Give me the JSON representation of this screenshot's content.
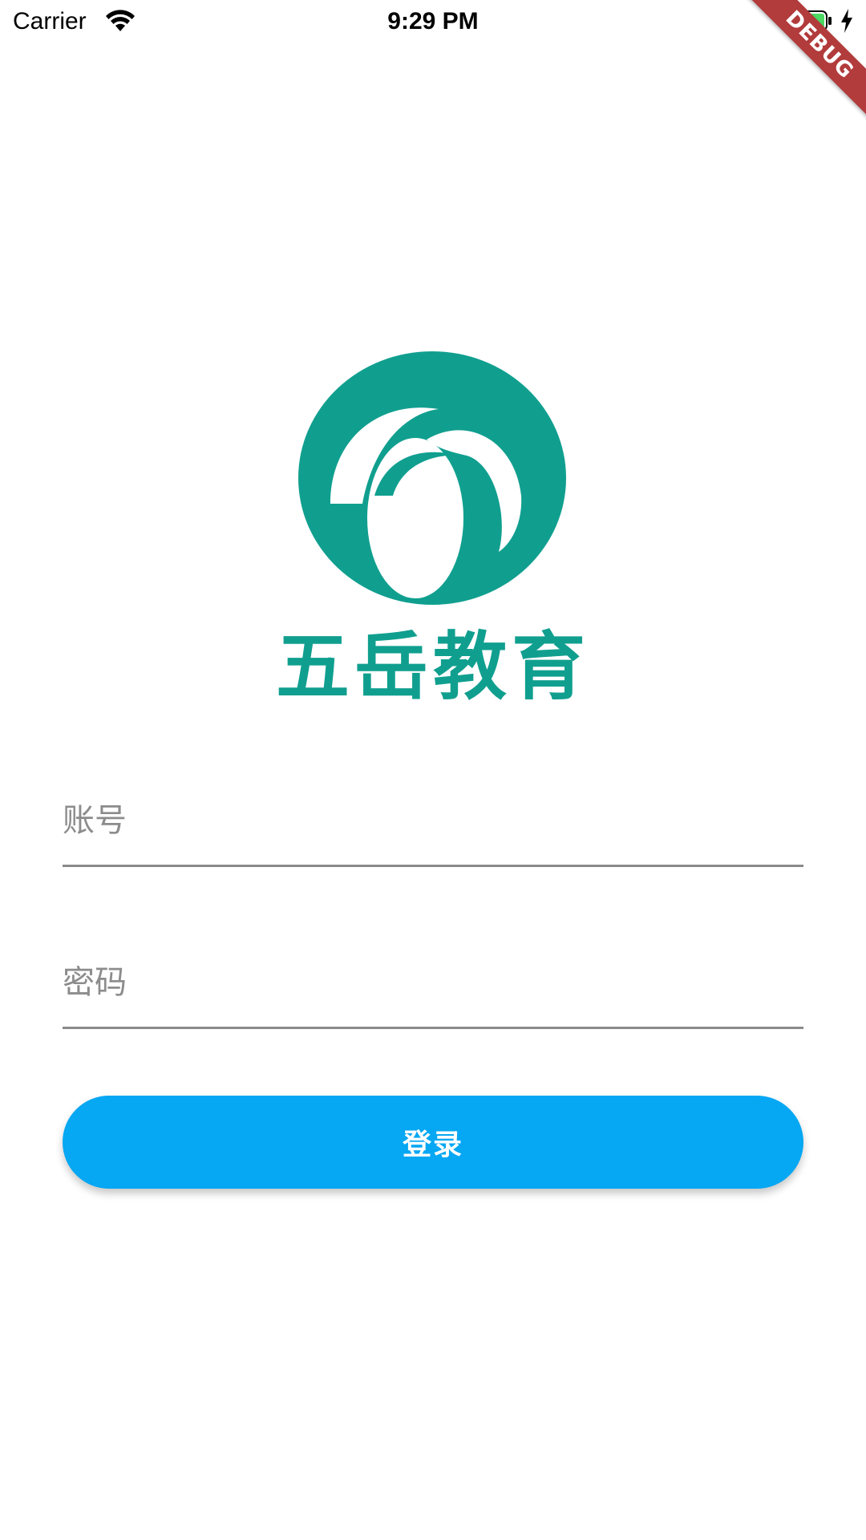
{
  "status_bar": {
    "carrier": "Carrier",
    "time": "9:29 PM",
    "battery_color": "#4cd964"
  },
  "debug_banner": {
    "label": "DEBUG",
    "color": "#b23b3b"
  },
  "logo": {
    "brand_name": "五岳教育",
    "color": "#109f8f",
    "icon": "wuyue-logo-icon"
  },
  "form": {
    "account": {
      "placeholder": "账号",
      "value": ""
    },
    "password": {
      "placeholder": "密码",
      "value": ""
    },
    "login_label": "登录",
    "login_color": "#06a7f3"
  }
}
